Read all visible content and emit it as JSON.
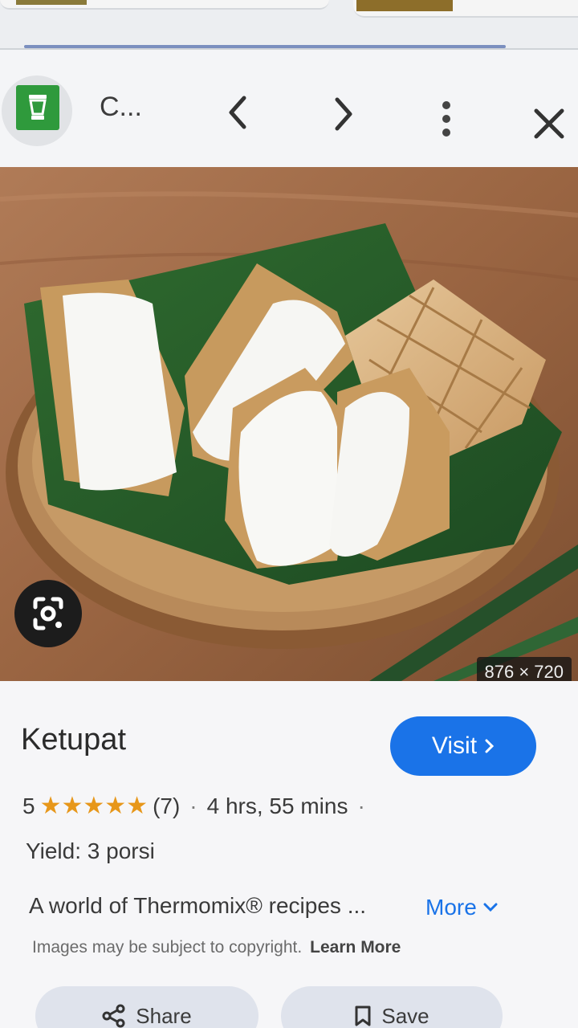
{
  "header": {
    "site_name": "C...",
    "site_logo_icon": "thermomix-logo-icon",
    "prev_icon": "chevron-left-icon",
    "next_icon": "chevron-right-icon",
    "menu_icon": "more-vert-icon",
    "close_icon": "close-icon"
  },
  "image": {
    "dimensions": "876 × 720",
    "lens_icon": "google-lens-icon"
  },
  "result": {
    "title": "Ketupat",
    "visit_label": "Visit",
    "rating": "5",
    "stars": "★★★★★",
    "review_count": "(7)",
    "duration": "4 hrs, 55 mins",
    "yield": "Yield: 3 porsi",
    "description": "A world of Thermomix® recipes ...",
    "more_label": "More",
    "copyright": "Images may be subject to copyright.",
    "learn_more": "Learn More",
    "share_label": "Share",
    "save_label": "Save"
  },
  "colors": {
    "accent": "#1a73e8",
    "star": "#e7971a",
    "logo": "#2f9a3c"
  }
}
